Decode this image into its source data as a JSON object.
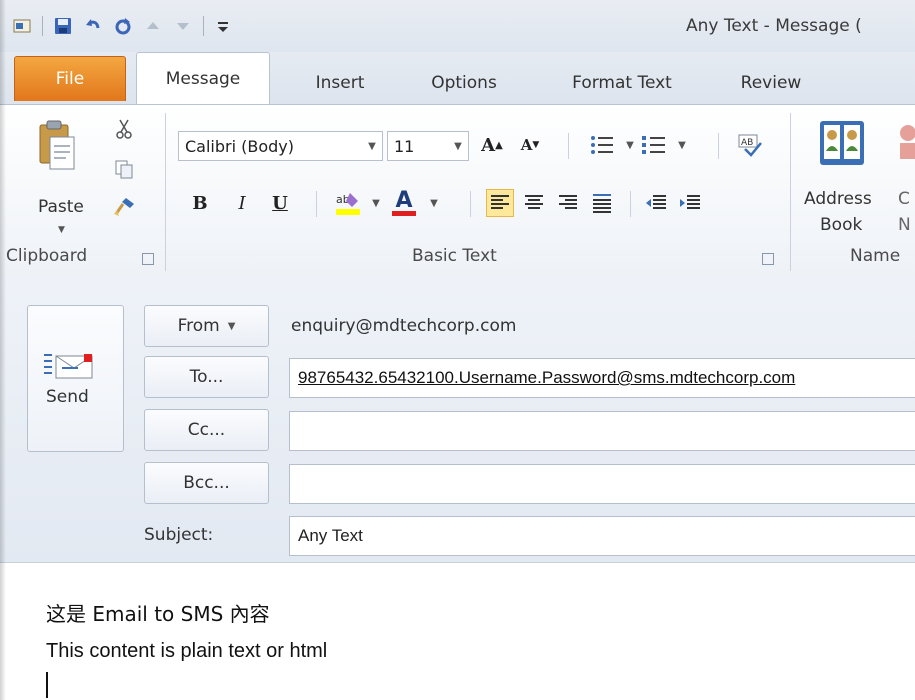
{
  "window": {
    "title": "Any Text - Message ("
  },
  "tabs": [
    {
      "label": "File"
    },
    {
      "label": "Message"
    },
    {
      "label": "Insert"
    },
    {
      "label": "Options"
    },
    {
      "label": "Format Text"
    },
    {
      "label": "Review"
    }
  ],
  "ribbon": {
    "clipboard": {
      "label": "Clipboard",
      "paste_label": "Paste"
    },
    "basic_text": {
      "label": "Basic Text",
      "font": "Calibri (Body)",
      "size": "11",
      "bold": "B",
      "italic": "I",
      "underline": "U",
      "grow": "A",
      "shrink": "A",
      "font_color": "A"
    },
    "names": {
      "label": "Name",
      "address_book_line1": "Address",
      "address_book_line2": "Book",
      "cut_c": "C",
      "cut_n": "N"
    }
  },
  "compose": {
    "send_label": "Send",
    "from_label": "From",
    "from_value": "enquiry@mdtechcorp.com",
    "to_label": "To...",
    "to_value": "98765432.65432100.Username.Password@sms.mdtechcorp.com",
    "cc_label": "Cc...",
    "cc_value": "",
    "bcc_label": "Bcc...",
    "bcc_value": "",
    "subject_label": "Subject:",
    "subject_value": "Any Text"
  },
  "body": {
    "line1": "这是 Email to SMS 內容",
    "line2": "This content is plain text or html"
  },
  "colors": {
    "file_tab": "#e2771b",
    "highlight": "#ffff00",
    "font_color": "#e02020",
    "selected": "#fde89b"
  }
}
